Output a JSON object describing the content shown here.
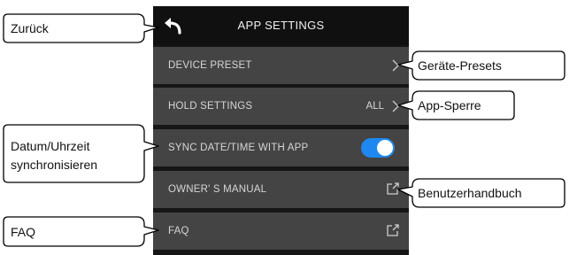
{
  "screen": {
    "title": "APP SETTINGS",
    "icons": {
      "back": "back-arrow-icon",
      "chevron": "chevron-right-icon",
      "external": "external-link-icon"
    },
    "rows": [
      {
        "label": "DEVICE PRESET",
        "value": ""
      },
      {
        "label": "HOLD SETTINGS",
        "value": "ALL"
      },
      {
        "label": "SYNC DATE/TIME WITH APP",
        "toggle_on": true
      },
      {
        "label": "OWNER' S MANUAL"
      },
      {
        "label": "FAQ"
      }
    ],
    "colors": {
      "background": "#161616",
      "row": "#444444",
      "toggle": "#1e88f0"
    }
  },
  "callouts": {
    "back": "Zurück",
    "device_preset": "Geräte-Presets",
    "hold_settings": "App-Sperre",
    "sync_line1": "Datum/Uhrzeit",
    "sync_line2": "synchronisieren",
    "manual": "Benutzerhandbuch",
    "faq": "FAQ"
  }
}
